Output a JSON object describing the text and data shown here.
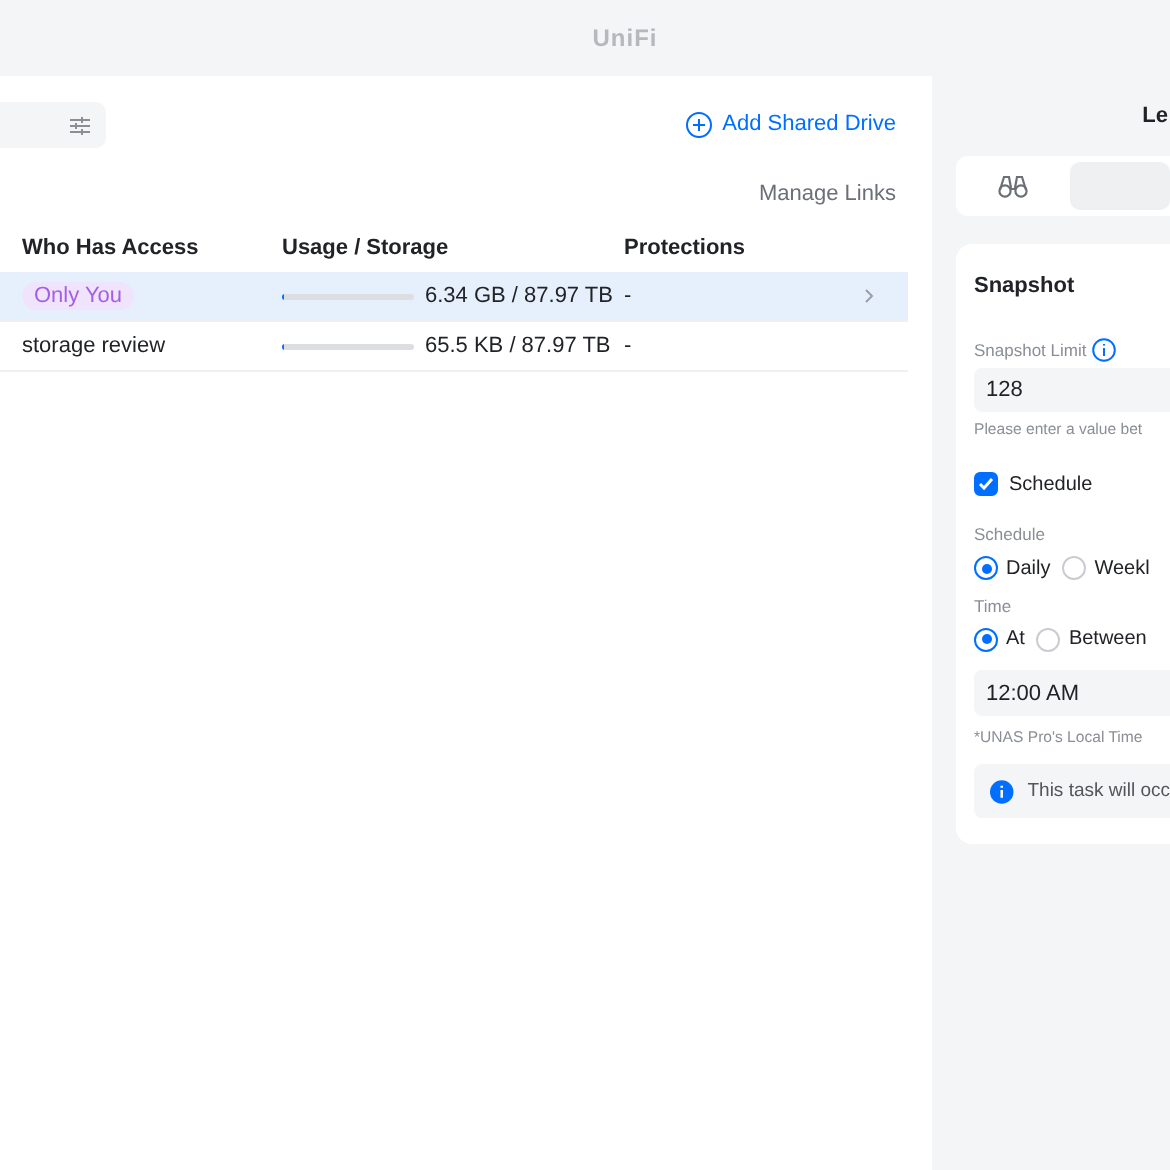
{
  "window": {
    "title": "UniFi"
  },
  "toolbar": {
    "add_button": "Add Shared Drive",
    "manage_links": "Manage Links"
  },
  "table": {
    "columns": [
      "Who Has Access",
      "Usage / Storage",
      "Protections"
    ],
    "rows": [
      {
        "access": {
          "text": "Only You",
          "kind": "badge"
        },
        "level": 0.01,
        "usage": "6.34 GB / 87.97 TB",
        "protections": "-",
        "selected": true
      },
      {
        "access": {
          "text": "storage review",
          "kind": "plain"
        },
        "level": 0.01,
        "usage": "65.5 KB / 87.97 TB",
        "protections": "-",
        "selected": false
      }
    ]
  },
  "panel": {
    "title": "Le",
    "tabs": [
      {
        "kind": "binoculars",
        "selected": true
      },
      {
        "kind": "other",
        "selected": false
      }
    ],
    "card": {
      "title": "Snapshot",
      "limit_label": "Snapshot Limit",
      "limit_value": "128",
      "limit_help": "Please enter a value bet",
      "schedule_check": {
        "label": "Schedule",
        "checked": true
      },
      "schedule_label": "Schedule",
      "schedule_options": [
        {
          "label": "Daily",
          "selected": true
        },
        {
          "label": "Weekl",
          "selected": false
        }
      ],
      "time_label": "Time",
      "time_options": [
        {
          "label": "At",
          "selected": true
        },
        {
          "label": "Between",
          "selected": false
        }
      ],
      "time_value": "12:00 AM",
      "time_note": "*UNAS Pro's Local Time",
      "info": "This task will occ"
    }
  }
}
